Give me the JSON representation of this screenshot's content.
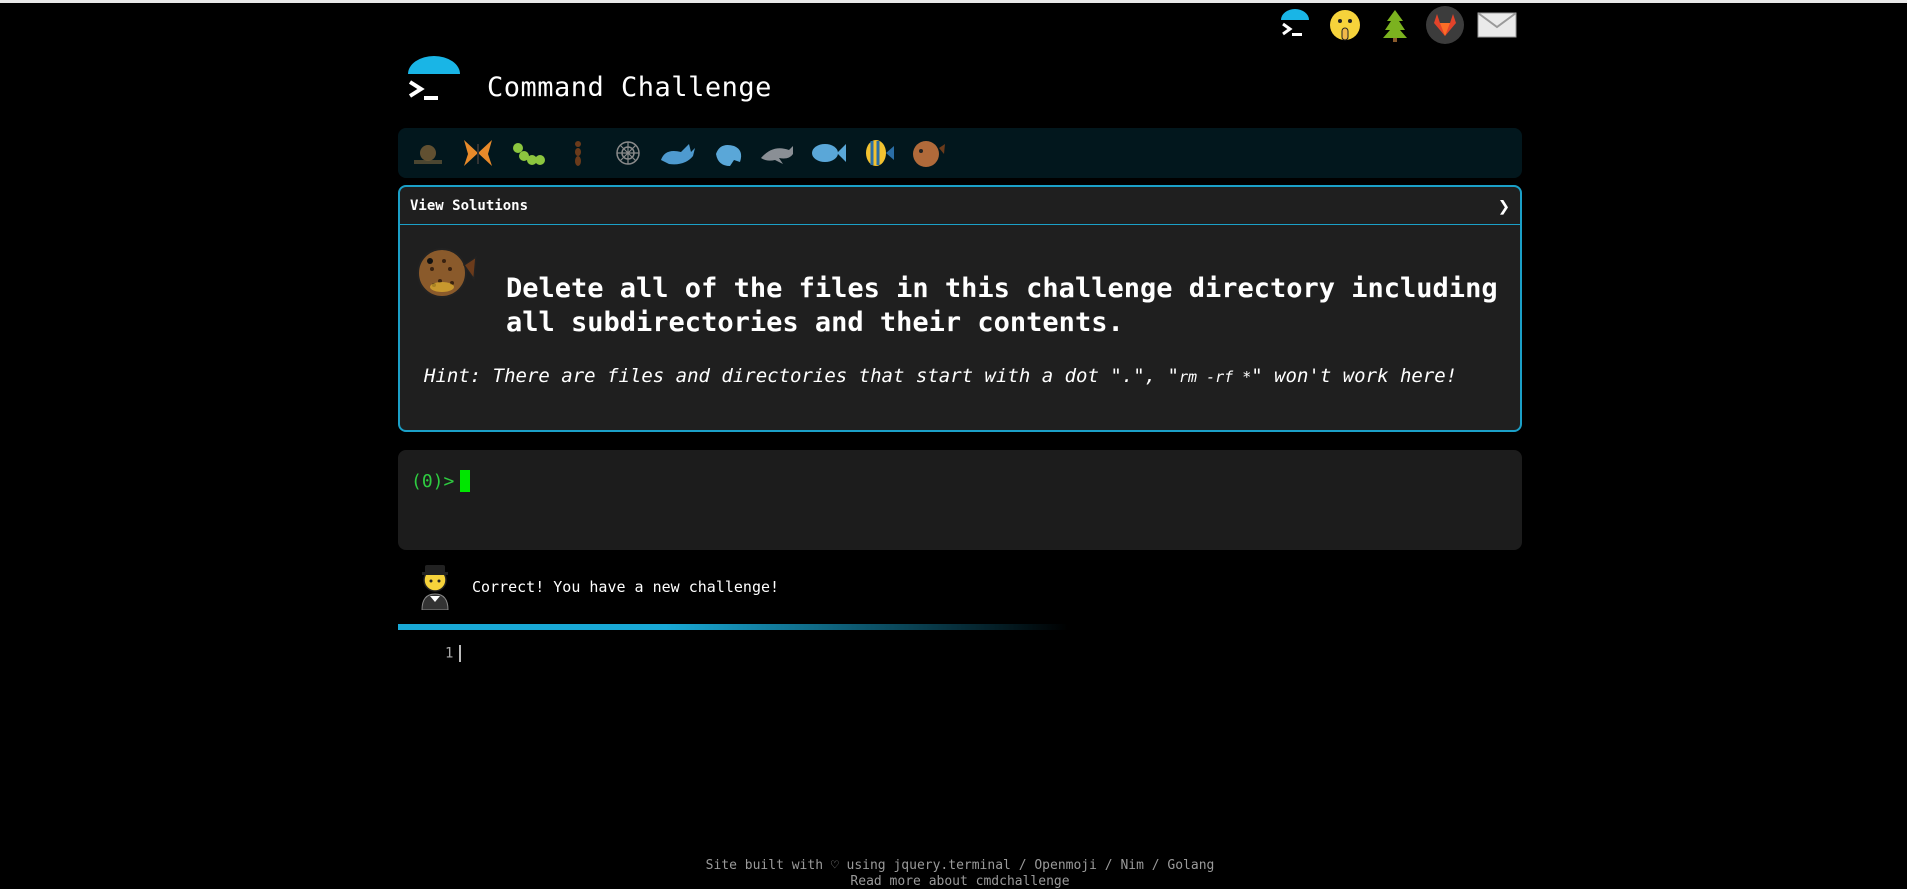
{
  "header": {
    "title": "Command Challenge"
  },
  "top_icons": [
    "terminal-icon",
    "shushing-face-icon",
    "tree-icon",
    "gitlab-icon",
    "mail-icon"
  ],
  "levels": [
    "snail-icon",
    "butterfly-icon",
    "caterpillar-icon",
    "ant-icon",
    "spider-web-icon",
    "whale-icon",
    "whale-spout-icon",
    "dolphin-icon",
    "fish-icon",
    "tropical-fish-icon",
    "blowfish-icon"
  ],
  "panel": {
    "view_solutions": "View Solutions",
    "chevron": "❯",
    "challenge": "Delete all of the files in this challenge directory including all subdirectories and their contents.",
    "hint_pre": "Hint: There are files and directories that start with a dot \".\", \"",
    "hint_cmd": "rm -rf *",
    "hint_post": "\" won't work here!"
  },
  "terminal": {
    "prompt": "(0)>"
  },
  "response": {
    "message": "Correct! You have a new challenge!"
  },
  "editor": {
    "line_number": "1"
  },
  "footer": {
    "line1": "Site built with ♡ using jquery.terminal / Openmoji / Nim / Golang",
    "line2": "Read more about cmdchallenge"
  },
  "colors": {
    "accent": "#1ba0c8",
    "prompt": "#2ecc40",
    "cursor": "#00e600",
    "panel_bg": "#1f1f1f",
    "level_bar_bg": "#02171d"
  }
}
